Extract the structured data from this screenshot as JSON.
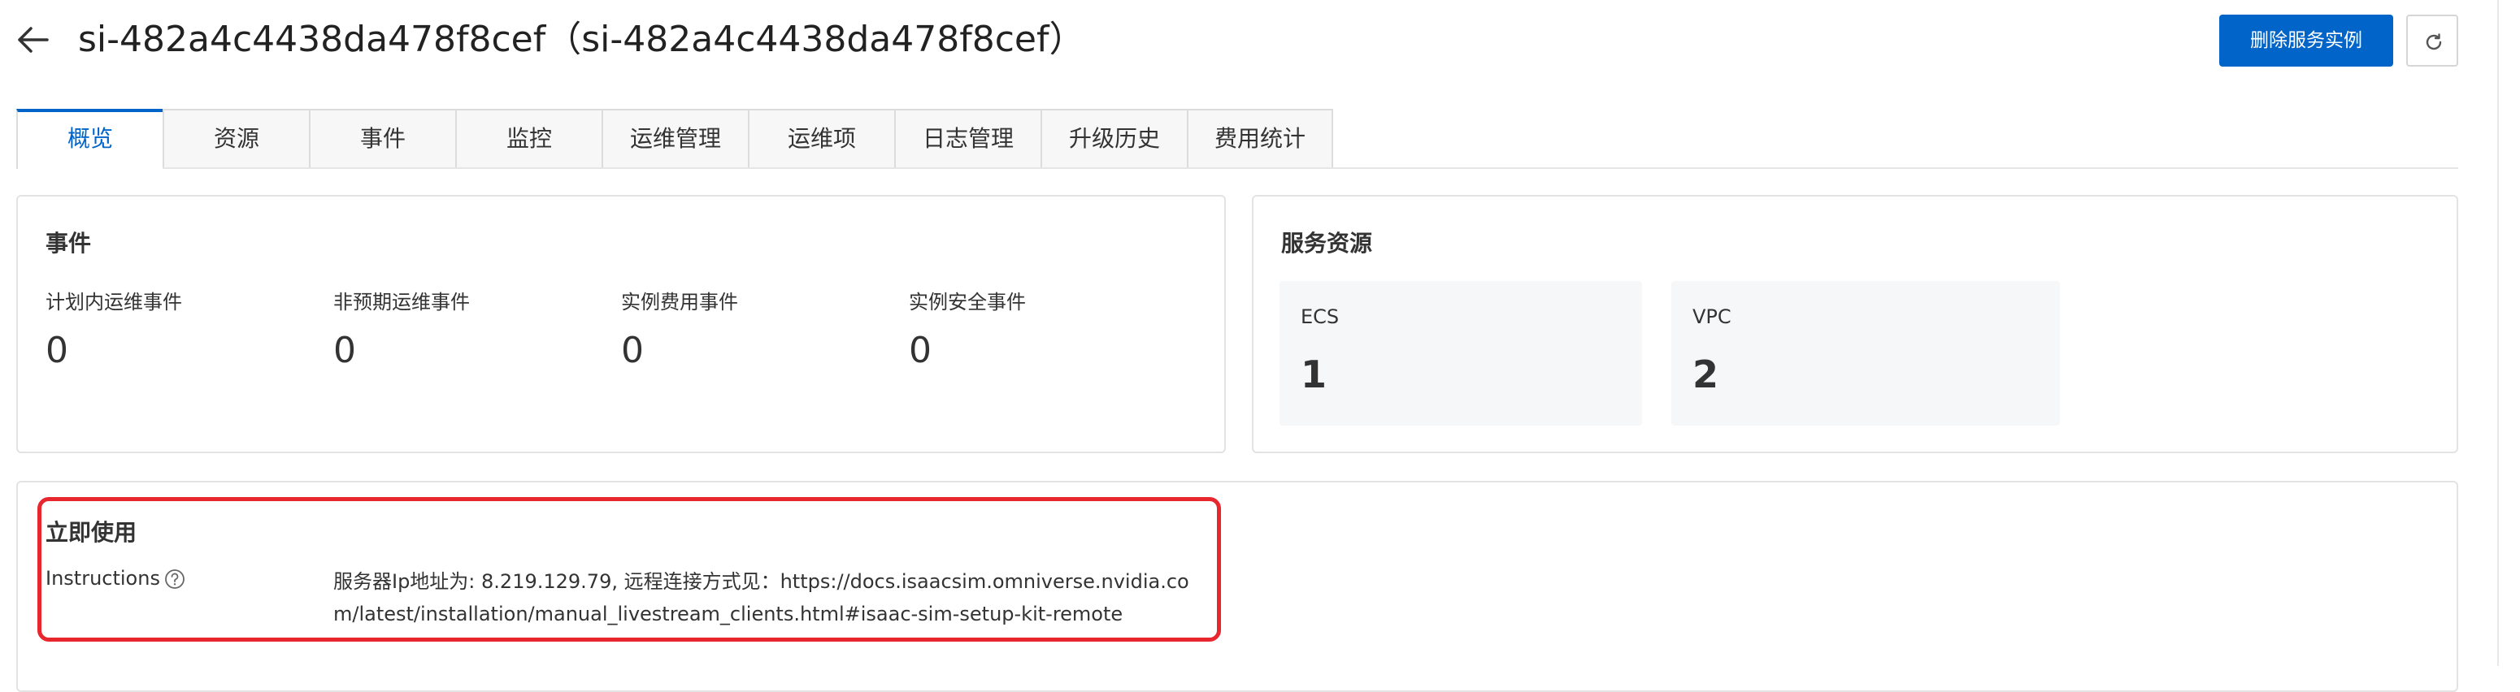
{
  "header": {
    "title": "si-482a4c4438da478f8cef（si-482a4c4438da478f8cef）",
    "delete_button": "删除服务实例",
    "back_icon": "arrow-left-icon",
    "refresh_icon": "refresh-icon"
  },
  "tabs": [
    {
      "label": "概览",
      "active": true
    },
    {
      "label": "资源"
    },
    {
      "label": "事件"
    },
    {
      "label": "监控"
    },
    {
      "label": "运维管理"
    },
    {
      "label": "运维项"
    },
    {
      "label": "日志管理"
    },
    {
      "label": "升级历史"
    },
    {
      "label": "费用统计"
    }
  ],
  "events": {
    "title": "事件",
    "items": [
      {
        "label": "计划内运维事件",
        "value": "0"
      },
      {
        "label": "非预期运维事件",
        "value": "0"
      },
      {
        "label": "实例费用事件",
        "value": "0"
      },
      {
        "label": "实例安全事件",
        "value": "0"
      }
    ]
  },
  "resources": {
    "title": "服务资源",
    "items": [
      {
        "label": "ECS",
        "value": "1"
      },
      {
        "label": "VPC",
        "value": "2"
      }
    ]
  },
  "quick_use": {
    "title": "立即使用",
    "instructions_label": "Instructions",
    "help_icon": "question-circle-icon",
    "instructions_text": "服务器Ip地址为: 8.219.129.79, 远程连接方式见：https://docs.isaacsim.omniverse.nvidia.com/latest/installation/manual_livestream_clients.html#isaac-sim-setup-kit-remote"
  },
  "colors": {
    "primary": "#0064c8",
    "highlight": "#e8262e",
    "tile_bg": "#f6f7f8"
  }
}
